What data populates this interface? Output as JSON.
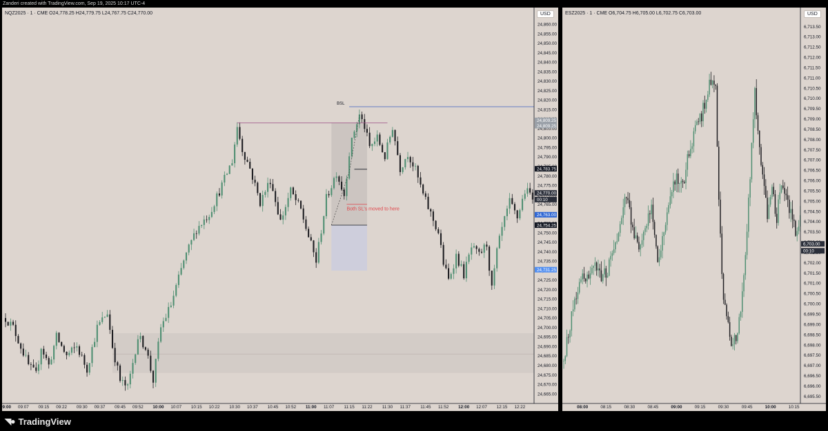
{
  "top_bar": {
    "text": "Zanderi created with TradingView.com, Sep 19, 2025 10:17 UTC-4"
  },
  "brand": {
    "name": "TradingView"
  },
  "colors": {
    "bg": "#ddd5cf",
    "up": "#4f8f72",
    "down": "#1e1e22",
    "sel_bar": "#2e66d4",
    "bsl_line": "#3a5bbf",
    "level_line": "#9b4f86",
    "note": "#e0474c"
  },
  "left_chart": {
    "legend": "NQZ2025 · 1 · CME  O24,778.25  H24,779.75  L24,767.75  C24,770.00",
    "currency": "USD"
  },
  "right_chart": {
    "legend": "ESZ2025 · 1 · CME  O6,704.75  H6,705.00  L6,702.75  C6,703.00",
    "currency": "USD"
  },
  "chart_data": [
    {
      "type": "line",
      "symbol": "NQZ2025",
      "chart_kind": "candlestick",
      "ylim": [
        24661,
        24863
      ],
      "y_ticks": [
        "24,665.00",
        "24,670.00",
        "24,675.00",
        "24,680.00",
        "24,685.00",
        "24,690.00",
        "24,695.00",
        "24,700.00",
        "24,705.00",
        "24,710.00",
        "24,715.00",
        "24,720.00",
        "24,725.00",
        "24,730.00",
        "24,735.00",
        "24,740.00",
        "24,745.00",
        "24,750.00",
        "24,755.00",
        "24,760.00",
        "24,765.00",
        "24,770.00",
        "24,775.00",
        "24,780.00",
        "24,785.00",
        "24,790.00",
        "24,795.00",
        "24,800.00",
        "24,805.00",
        "24,810.00",
        "24,815.00",
        "24,820.00",
        "24,825.00",
        "24,830.00",
        "24,835.00",
        "24,840.00",
        "24,845.00",
        "24,850.00",
        "24,855.00",
        "24,860.00"
      ],
      "x_ticks": [
        {
          "t": 0,
          "label": "09:00",
          "bold": true
        },
        {
          "t": 7,
          "label": "09:07"
        },
        {
          "t": 15,
          "label": "09:15"
        },
        {
          "t": 22,
          "label": "09:22"
        },
        {
          "t": 30,
          "label": "09:30"
        },
        {
          "t": 37,
          "label": "09:37"
        },
        {
          "t": 45,
          "label": "09:45"
        },
        {
          "t": 52,
          "label": "09:52"
        },
        {
          "t": 60,
          "label": "10:00",
          "bold": true
        },
        {
          "t": 67,
          "label": "10:07"
        },
        {
          "t": 75,
          "label": "10:15"
        },
        {
          "t": 82,
          "label": "10:22"
        },
        {
          "t": 90,
          "label": "10:30"
        },
        {
          "t": 97,
          "label": "10:37"
        },
        {
          "t": 105,
          "label": "10:45"
        },
        {
          "t": 112,
          "label": "10:52"
        },
        {
          "t": 120,
          "label": "11:00",
          "bold": true
        },
        {
          "t": 127,
          "label": "11:07"
        },
        {
          "t": 135,
          "label": "11:15"
        },
        {
          "t": 142,
          "label": "11:22"
        },
        {
          "t": 150,
          "label": "11:30"
        },
        {
          "t": 157,
          "label": "11:37"
        },
        {
          "t": 165,
          "label": "11:45"
        },
        {
          "t": 172,
          "label": "11:52"
        },
        {
          "t": 180,
          "label": "12:00",
          "bold": true
        },
        {
          "t": 187,
          "label": "12:07"
        },
        {
          "t": 195,
          "label": "12:15"
        },
        {
          "t": 202,
          "label": "12:22"
        }
      ],
      "tmax": 207,
      "anchors": [
        [
          0,
          24705
        ],
        [
          3,
          24700
        ],
        [
          6,
          24690
        ],
        [
          9,
          24680
        ],
        [
          12,
          24675
        ],
        [
          14,
          24690
        ],
        [
          17,
          24680
        ],
        [
          20,
          24695
        ],
        [
          24,
          24685
        ],
        [
          28,
          24690
        ],
        [
          32,
          24678
        ],
        [
          36,
          24700
        ],
        [
          40,
          24708
        ],
        [
          42,
          24690
        ],
        [
          45,
          24672
        ],
        [
          48,
          24668
        ],
        [
          52,
          24695
        ],
        [
          55,
          24690
        ],
        [
          58,
          24672
        ],
        [
          61,
          24700
        ],
        [
          65,
          24712
        ],
        [
          70,
          24735
        ],
        [
          75,
          24752
        ],
        [
          80,
          24760
        ],
        [
          85,
          24775
        ],
        [
          89,
          24788
        ],
        [
          91,
          24806
        ],
        [
          93,
          24794
        ],
        [
          96,
          24784
        ],
        [
          100,
          24766
        ],
        [
          104,
          24778
        ],
        [
          108,
          24756
        ],
        [
          112,
          24772
        ],
        [
          116,
          24762
        ],
        [
          119,
          24748
        ],
        [
          122,
          24735
        ],
        [
          126,
          24768
        ],
        [
          130,
          24782
        ],
        [
          133,
          24770
        ],
        [
          135,
          24792
        ],
        [
          137,
          24804
        ],
        [
          139,
          24812
        ],
        [
          141,
          24806
        ],
        [
          143,
          24795
        ],
        [
          146,
          24800
        ],
        [
          149,
          24790
        ],
        [
          152,
          24806
        ],
        [
          155,
          24784
        ],
        [
          158,
          24792
        ],
        [
          161,
          24783
        ],
        [
          164,
          24770
        ],
        [
          167,
          24760
        ],
        [
          170,
          24750
        ],
        [
          172,
          24734
        ],
        [
          174,
          24725
        ],
        [
          177,
          24738
        ],
        [
          180,
          24728
        ],
        [
          183,
          24742
        ],
        [
          186,
          24738
        ],
        [
          189,
          24744
        ],
        [
          191,
          24720
        ],
        [
          193,
          24740
        ],
        [
          195,
          24752
        ],
        [
          198,
          24766
        ],
        [
          201,
          24758
        ],
        [
          204,
          24772
        ],
        [
          207,
          24770
        ]
      ],
      "levels": [
        {
          "name": "BSL",
          "price": 24816.5,
          "t_from": 135,
          "t_to": 207,
          "kind": "bsl"
        },
        {
          "price": 24808,
          "t_from": 91,
          "t_to": 150,
          "kind": "high"
        },
        {
          "price": 24783.5,
          "t_from": 137,
          "t_to": 142,
          "kind": "black"
        },
        {
          "price": 24754,
          "t_from": 128,
          "t_to": 142,
          "kind": "black"
        },
        {
          "price": 24765,
          "t_from": 134,
          "t_to": 142,
          "kind": "red"
        }
      ],
      "annotation": "Both SL's moved to here",
      "position_box": {
        "t_from": 128,
        "t_to": 142,
        "top": 24808,
        "mid": 24754,
        "bottom": 24730
      },
      "zone": {
        "t_from": 42,
        "t_to": 207,
        "top": 24697,
        "mid": 24686,
        "bottom": 24676
      },
      "price_labels": [
        {
          "text": "24,809.25",
          "price": 24809.3,
          "bg": "#9aa0a8",
          "fg": "#ffffff"
        },
        {
          "text": "24,809.25",
          "price": 24806.5,
          "bg": "#9aa0a8",
          "fg": "#ffffff"
        },
        {
          "text": "24,783.75",
          "price": 24783.75,
          "bg": "#131722",
          "fg": "#ffffff"
        },
        {
          "text": "24,770.00",
          "price": 24771,
          "bg": "#2a2e39",
          "fg": "#ffffff"
        },
        {
          "text": "00:10",
          "price": 24767.5,
          "bg": "#2a2e39",
          "fg": "#ffffff"
        },
        {
          "text": "24,763.00",
          "price": 24759.5,
          "bg": "#2e66d4",
          "fg": "#ffffff"
        },
        {
          "text": "24,754.25",
          "price": 24754,
          "bg": "#131722",
          "fg": "#ffffff"
        },
        {
          "text": "24,731.25",
          "price": 24730.5,
          "bg": "#4f8df0",
          "fg": "#ffffff"
        }
      ]
    },
    {
      "type": "line",
      "symbol": "ESZ2025",
      "chart_kind": "candlestick",
      "ylim": [
        6695.25,
        6714.12
      ],
      "y_ticks": [
        "6,695.50",
        "6,696.00",
        "6,696.50",
        "6,697.00",
        "6,697.50",
        "6,698.00",
        "6,698.50",
        "6,699.00",
        "6,699.50",
        "6,700.00",
        "6,700.50",
        "6,701.00",
        "6,701.50",
        "6,702.00",
        "6,702.50",
        "6,703.00",
        "6,703.50",
        "6,704.00",
        "6,704.50",
        "6,705.00",
        "6,705.50",
        "6,706.00",
        "6,706.50",
        "6,707.00",
        "6,707.50",
        "6,708.00",
        "6,708.50",
        "6,709.00",
        "6,709.50",
        "6,710.00",
        "6,710.50",
        "6,711.00",
        "6,711.50",
        "6,712.00",
        "6,712.50",
        "6,713.00",
        "6,713.50"
      ],
      "x_ticks": [
        {
          "t": 0,
          "label": "08:00",
          "bold": true
        },
        {
          "t": 15,
          "label": "08:15"
        },
        {
          "t": 30,
          "label": "08:30"
        },
        {
          "t": 45,
          "label": "08:45"
        },
        {
          "t": 60,
          "label": "09:00",
          "bold": true
        },
        {
          "t": 75,
          "label": "09:15"
        },
        {
          "t": 90,
          "label": "09:30"
        },
        {
          "t": 105,
          "label": "09:45"
        },
        {
          "t": 120,
          "label": "10:00",
          "bold": true
        },
        {
          "t": 135,
          "label": "10:15"
        }
      ],
      "tmin": -12,
      "tmax": 140,
      "anchors": [
        [
          -12,
          6697.2
        ],
        [
          -8,
          6699
        ],
        [
          -4,
          6700.5
        ],
        [
          0,
          6701.5
        ],
        [
          4,
          6701.2
        ],
        [
          8,
          6701.8
        ],
        [
          12,
          6701.2
        ],
        [
          16,
          6701.6
        ],
        [
          20,
          6702.6
        ],
        [
          24,
          6704
        ],
        [
          28,
          6705.2
        ],
        [
          32,
          6703.8
        ],
        [
          36,
          6702.6
        ],
        [
          40,
          6703.6
        ],
        [
          44,
          6704.6
        ],
        [
          48,
          6702
        ],
        [
          52,
          6703.6
        ],
        [
          56,
          6705.2
        ],
        [
          60,
          6706.2
        ],
        [
          64,
          6705.6
        ],
        [
          68,
          6707.4
        ],
        [
          72,
          6708.6
        ],
        [
          76,
          6709.2
        ],
        [
          80,
          6710.4
        ],
        [
          83,
          6711.2
        ],
        [
          85,
          6710.6
        ],
        [
          87,
          6705
        ],
        [
          90,
          6700
        ],
        [
          93,
          6699
        ],
        [
          96,
          6697.8
        ],
        [
          99,
          6698.8
        ],
        [
          102,
          6700.5
        ],
        [
          105,
          6703.8
        ],
        [
          108,
          6707.6
        ],
        [
          110,
          6710.4
        ],
        [
          112,
          6708.2
        ],
        [
          115,
          6706.4
        ],
        [
          118,
          6704.4
        ],
        [
          121,
          6705.6
        ],
        [
          124,
          6704.2
        ],
        [
          127,
          6706
        ],
        [
          130,
          6705
        ],
        [
          133,
          6704.6
        ],
        [
          136,
          6703.6
        ],
        [
          139,
          6704
        ]
      ],
      "price_labels": [
        {
          "text": "6,703.00",
          "price": 6702.92,
          "bg": "#2a2e39",
          "fg": "#ffffff"
        },
        {
          "text": "00:10",
          "price": 6702.58,
          "bg": "#2a2e39",
          "fg": "#ffffff"
        }
      ]
    }
  ]
}
